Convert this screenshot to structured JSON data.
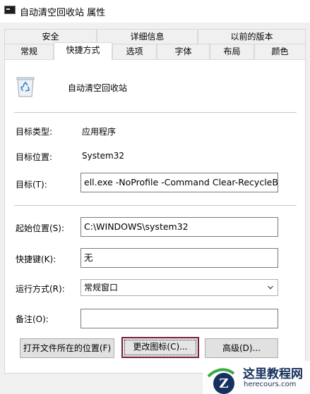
{
  "window": {
    "title": "自动清空回收站 属性"
  },
  "tabs_top": [
    {
      "label": "安全"
    },
    {
      "label": "详细信息"
    },
    {
      "label": "以前的版本"
    }
  ],
  "tabs_bottom": [
    {
      "label": "常规"
    },
    {
      "label": "快捷方式",
      "active": true
    },
    {
      "label": "选项"
    },
    {
      "label": "字体"
    },
    {
      "label": "布局"
    },
    {
      "label": "颜色"
    }
  ],
  "shortcut": {
    "name": "自动清空回收站",
    "icon": "recycle-bin-icon",
    "target_type_label": "目标类型:",
    "target_type_value": "应用程序",
    "target_location_label": "目标位置:",
    "target_location_value": "System32",
    "target_label": "目标(T):",
    "target_value": "ell.exe -NoProfile -Command Clear-RecycleBin\"",
    "start_in_label": "起始位置(S):",
    "start_in_value": "C:\\WINDOWS\\system32",
    "hotkey_label": "快捷键(K):",
    "hotkey_value": "无",
    "run_label": "运行方式(R):",
    "run_value": "常规窗口",
    "comment_label": "备注(O):",
    "comment_value": ""
  },
  "buttons": {
    "open_location": "打开文件所在的位置(F)",
    "change_icon": "更改图标(C)...",
    "advanced": "高级(D)..."
  },
  "watermark": {
    "text": "这里教程网",
    "url": "herecours.com",
    "letter": "Z"
  },
  "colors": {
    "focus_border": "#7a1f3d",
    "watermark_blue": "#17305f",
    "watermark_green": "#3aa845"
  }
}
